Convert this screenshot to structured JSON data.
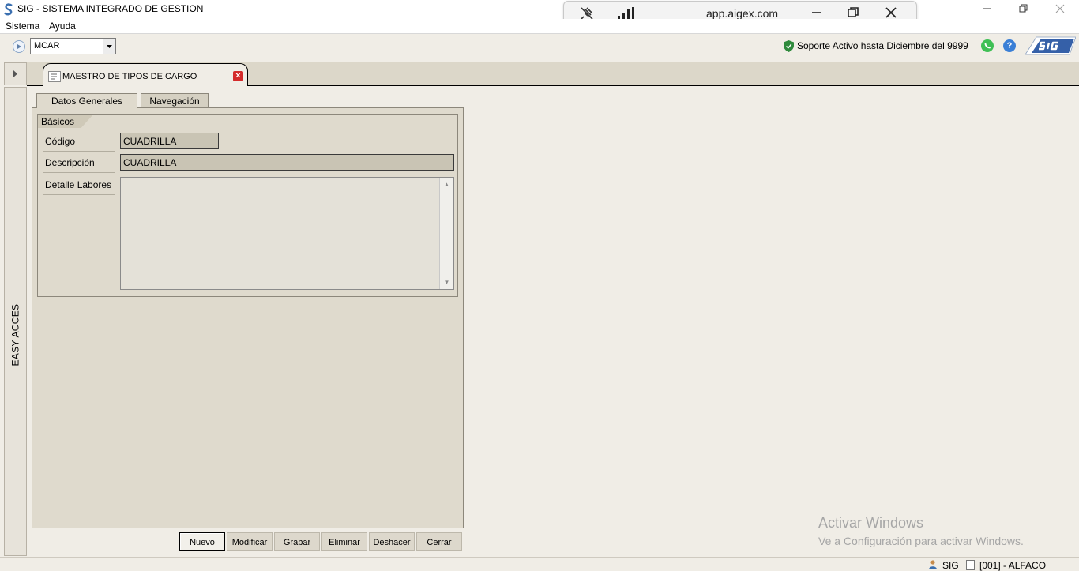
{
  "window": {
    "title": "SIG - SISTEMA INTEGRADO DE GESTION",
    "controls": [
      "minimize",
      "restore",
      "close"
    ]
  },
  "remote_bar": {
    "url": "app.aigex.com",
    "icons": [
      "pin-off-icon",
      "signal-icon"
    ],
    "controls": [
      "minimize",
      "restore",
      "close"
    ]
  },
  "menubar": {
    "items": [
      "Sistema",
      "Ayuda"
    ]
  },
  "toolbar": {
    "module_value": "MCAR",
    "support_text": "Soporte Activo hasta Diciembre del 9999",
    "help_glyph": "?"
  },
  "sidebar": {
    "label": "EASY ACCES"
  },
  "document_tab": {
    "title": "MAESTRO DE TIPOS DE CARGO"
  },
  "tabs": [
    {
      "label": "Datos Generales",
      "active": true
    },
    {
      "label": "Navegación",
      "active": false
    }
  ],
  "group": {
    "title": "Básicos"
  },
  "form": {
    "codigo_label": "Código",
    "codigo_value": "CUADRILLA",
    "descripcion_label": "Descripción",
    "descripcion_value": "CUADRILLA",
    "detalle_label": "Detalle Labores",
    "detalle_value": ""
  },
  "buttons": {
    "nuevo": "Nuevo",
    "modificar": "Modificar",
    "grabar": "Grabar",
    "eliminar": "Eliminar",
    "deshacer": "Deshacer",
    "cerrar": "Cerrar"
  },
  "watermark": {
    "title": "Activar Windows",
    "subtitle": "Ve a Configuración para activar Windows."
  },
  "statusbar": {
    "app": "SIG",
    "company": "[001] - ALFACO"
  },
  "colors": {
    "panel": "#dfdacd",
    "field": "#c9c4b4",
    "close_red": "#d42a2a",
    "help_blue": "#3a7fd6",
    "whatsapp_green": "#3fbf55"
  }
}
